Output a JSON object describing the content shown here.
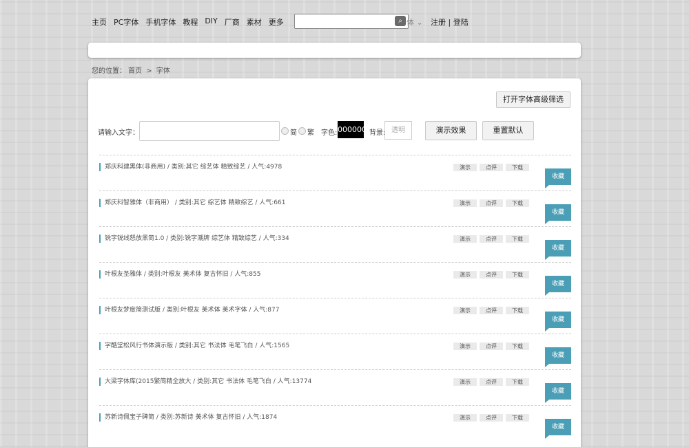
{
  "nav": {
    "items": [
      "主页",
      "PC字体",
      "手机字体",
      "教程",
      "DIY",
      "厂商",
      "素材",
      "更多"
    ]
  },
  "search": {
    "value": "",
    "button_icon": "search-icon",
    "extra": "体 ⌄"
  },
  "auth": {
    "register": "注册",
    "separator": "|",
    "login": "登陆"
  },
  "breadcrumb": {
    "prefix": "您的位置：",
    "home": "首页",
    "sep": ">",
    "current": "字体"
  },
  "filters": {
    "advanced_button": "打开字体高级筛选",
    "input_label": "请输入文字：",
    "input_value": "",
    "simplified_label": "简",
    "traditional_label": "繁",
    "color_label": "字色:",
    "color_value": "000000",
    "bg_label": "背景:",
    "bg_value": "透明",
    "demo_button": "演示效果",
    "reset_button": "重置默认"
  },
  "accent_color": "#4a9eb5",
  "actions": {
    "demo": "演示",
    "comment": "点评",
    "download": "下载",
    "favorite": "收藏"
  },
  "fonts": [
    "郑庆科建黑体(非商用) / 类别:其它 综艺体 精致综艺 / 人气:4978",
    "郑庆科智雅体（非商用） / 类别:其它 综艺体 精致综艺 / 人气:661",
    "锐字锐线怒放黑简1.0 / 类别:锐字潮牌 综艺体 精致综艺 / 人气:334",
    "叶根友圣雅体 / 类别:叶根友 美术体 复古怀旧 / 人气:855",
    "叶根友梦度简测试版 / 类别:叶根友 美术体 美术字体 / 人气:877",
    "字酷堂松风行书体演示版 / 类别:其它 书法体 毛笔飞白 / 人气:1565",
    "大梁字体库(2015繁简精全放大 / 类别:其它 书法体 毛笔飞白 / 人气:13774",
    "苏新诗佩宝子碑简 / 类别:苏新诗 美术体 复古怀旧 / 人气:1874"
  ]
}
